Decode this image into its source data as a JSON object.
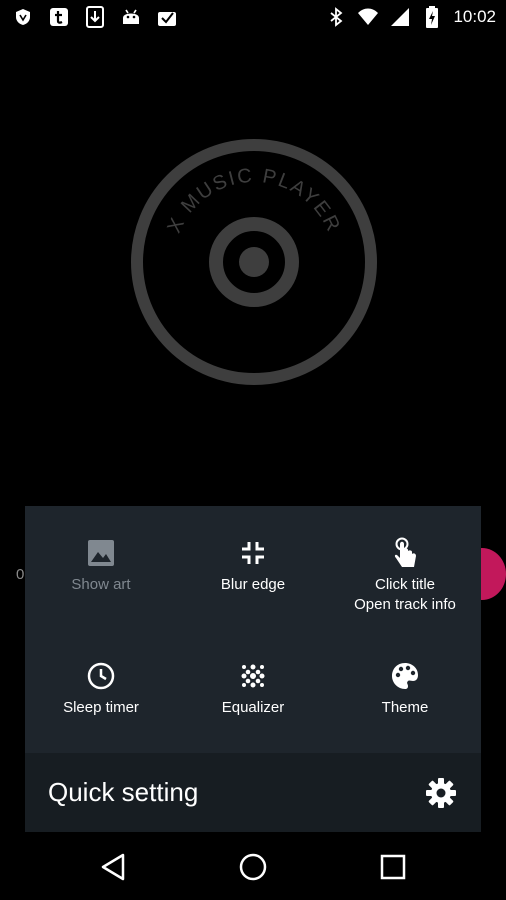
{
  "status_bar": {
    "time": "10:02",
    "left_icons": [
      "shield-icon",
      "tumblr-icon",
      "download-icon",
      "android-icon",
      "checkbox-icon"
    ],
    "right_icons": [
      "bluetooth-icon",
      "wifi-icon",
      "signal-icon",
      "battery-icon"
    ]
  },
  "logo": {
    "text": "X MUSIC PLAYER"
  },
  "edge": {
    "left_text": "0"
  },
  "quick_settings": {
    "title": "Quick setting",
    "tiles": [
      {
        "label": "Show art",
        "icon": "image-icon",
        "enabled": false
      },
      {
        "label": "Blur edge",
        "icon": "collapse-icon",
        "enabled": true
      },
      {
        "label_line1": "Click title",
        "label_line2": "Open track info",
        "icon": "touch-icon",
        "enabled": true
      },
      {
        "label": "Sleep timer",
        "icon": "clock-icon",
        "enabled": true
      },
      {
        "label": "Equalizer",
        "icon": "equalizer-dots-icon",
        "enabled": true
      },
      {
        "label": "Theme",
        "icon": "palette-icon",
        "enabled": true
      }
    ]
  },
  "navigation": {
    "buttons": [
      "back-icon",
      "home-icon",
      "recents-icon"
    ]
  },
  "colors": {
    "panel": "#1e252c",
    "footer": "#171d22",
    "accent": "#c2185b",
    "background": "#000000"
  }
}
